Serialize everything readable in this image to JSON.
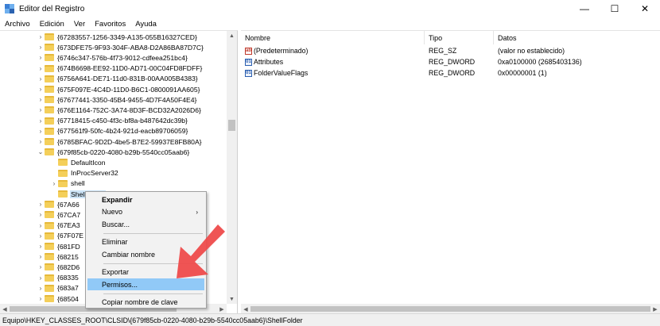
{
  "window": {
    "title": "Editor del Registro",
    "controls": {
      "minimize": "—",
      "maximize": "☐",
      "close": "✕"
    }
  },
  "menubar": [
    "Archivo",
    "Edición",
    "Ver",
    "Favoritos",
    "Ayuda"
  ],
  "tree": {
    "rows": [
      {
        "label": "{67283557-1256-3349-A135-055B16327CED}",
        "expanded": false
      },
      {
        "label": "{673DFE75-9F93-304F-ABA8-D2A86BA87D7C}",
        "expanded": false
      },
      {
        "label": "{6746c347-576b-4f73-9012-cdfeea251bc4}",
        "expanded": false
      },
      {
        "label": "{674B6698-EE92-11D0-AD71-00C04FD8FDFF}",
        "expanded": false
      },
      {
        "label": "{6756A641-DE71-11d0-831B-00AA005B4383}",
        "expanded": false
      },
      {
        "label": "{675F097E-4C4D-11D0-B6C1-0800091AA605}",
        "expanded": false
      },
      {
        "label": "{67677441-3350-45B4-9455-4D7F4A50F4E4}",
        "expanded": false
      },
      {
        "label": "{676E1164-752C-3A74-8D3F-BCD32A2026D6}",
        "expanded": false
      },
      {
        "label": "{67718415-c450-4f3c-bf8a-b487642dc39b}",
        "expanded": false
      },
      {
        "label": "{677561f9-50fc-4b24-921d-eacb89706059}",
        "expanded": false
      },
      {
        "label": "{6785BFAC-9D2D-4be5-B7E2-59937E8FB80A}",
        "expanded": false
      },
      {
        "label": "{679f85cb-0220-4080-b29b-5540cc05aab6}",
        "expanded": true
      },
      {
        "label": "DefaultIcon",
        "child": true
      },
      {
        "label": "InProcServer32",
        "child": true
      },
      {
        "label": "shell",
        "child": true,
        "expandable": true
      },
      {
        "label": "ShellFolder",
        "child": true,
        "selected": true
      },
      {
        "label": "{67A66"
      },
      {
        "label": "{67CA7"
      },
      {
        "label": "{67EA3"
      },
      {
        "label": "{67F07E"
      },
      {
        "label": "{681FD"
      },
      {
        "label": "{68215"
      },
      {
        "label": "{682D6"
      },
      {
        "label": "{68335"
      },
      {
        "label": "{683a7"
      },
      {
        "label": "{68504"
      }
    ]
  },
  "list": {
    "columns": [
      "Nombre",
      "Tipo",
      "Datos"
    ],
    "rows": [
      {
        "icon": "string-value-icon",
        "glyph": "ab",
        "kind": "sz",
        "name": "(Predeterminado)",
        "type": "REG_SZ",
        "data": "(valor no establecido)"
      },
      {
        "icon": "dword-value-icon",
        "glyph": "01",
        "kind": "dw",
        "name": "Attributes",
        "type": "REG_DWORD",
        "data": "0xa0100000 (2685403136)"
      },
      {
        "icon": "dword-value-icon",
        "glyph": "01",
        "kind": "dw",
        "name": "FolderValueFlags",
        "type": "REG_DWORD",
        "data": "0x00000001 (1)"
      }
    ]
  },
  "context_menu": {
    "items": [
      {
        "label": "Expandir",
        "bold": true
      },
      {
        "label": "Nuevo",
        "submenu": true
      },
      {
        "label": "Buscar..."
      },
      {
        "separator": true
      },
      {
        "label": "Eliminar"
      },
      {
        "label": "Cambiar nombre"
      },
      {
        "separator": true
      },
      {
        "label": "Exportar"
      },
      {
        "label": "Permisos...",
        "highlight": true
      },
      {
        "separator": true
      },
      {
        "label": "Copiar nombre de clave"
      }
    ]
  },
  "statusbar": {
    "path": "Equipo\\HKEY_CLASSES_ROOT\\CLSID\\{679f85cb-0220-4080-b29b-5540cc05aab6}\\ShellFolder"
  },
  "colors": {
    "selection": "#cce4f7",
    "menu_highlight": "#91c9f7",
    "annotation_arrow": "#ee4b4b",
    "folder": "#f4cf5a"
  }
}
